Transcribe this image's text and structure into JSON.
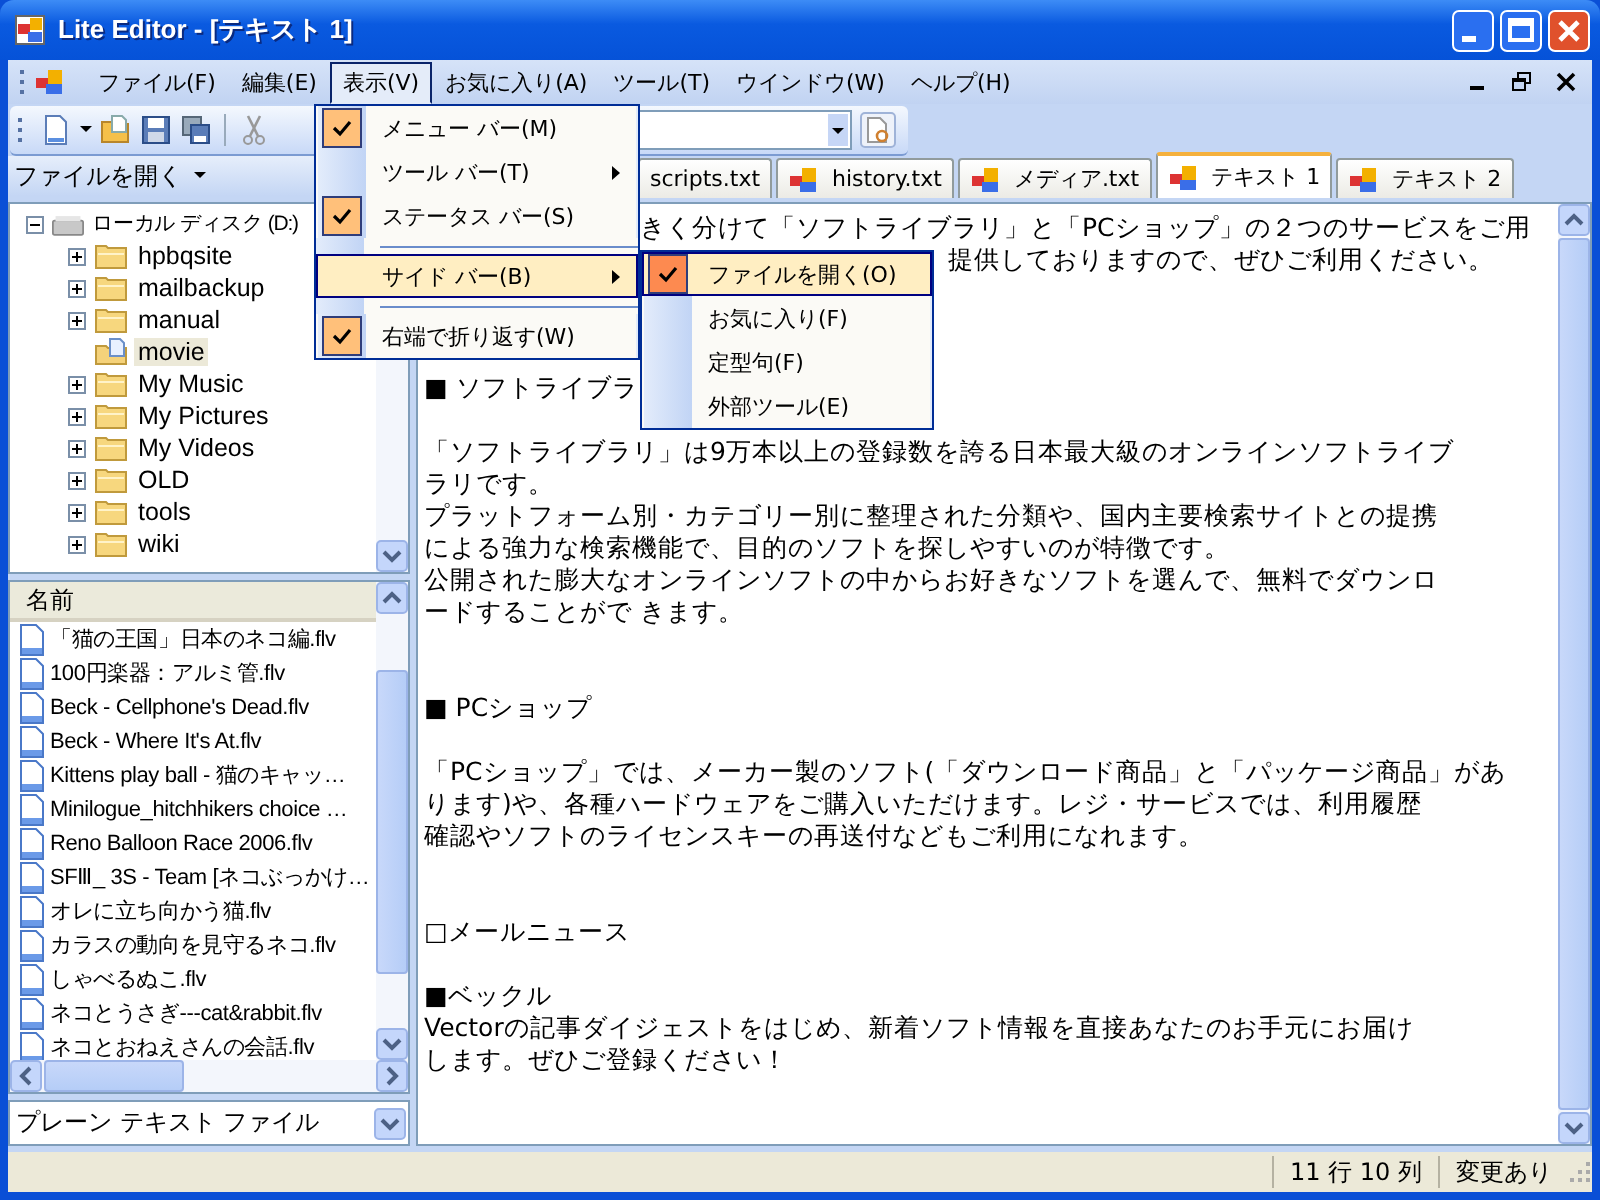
{
  "window": {
    "title": "Lite Editor - [テキスト 1]"
  },
  "menu_bar": {
    "items": [
      {
        "label": "ファイル(F)",
        "selected": false
      },
      {
        "label": "編集(E)",
        "selected": false
      },
      {
        "label": "表示(V)",
        "selected": true
      },
      {
        "label": "お気に入り(A)",
        "selected": false
      },
      {
        "label": "ツール(T)",
        "selected": false
      },
      {
        "label": "ウインドウ(W)",
        "selected": false
      },
      {
        "label": "ヘルプ(H)",
        "selected": false
      }
    ]
  },
  "view_menu": {
    "items": [
      {
        "kind": "item",
        "label": "メニュー バー(M)",
        "checked": true,
        "submenu": false,
        "selected": false
      },
      {
        "kind": "item",
        "label": "ツール バー(T)",
        "checked": false,
        "submenu": true,
        "selected": false
      },
      {
        "kind": "item",
        "label": "ステータス バー(S)",
        "checked": true,
        "submenu": false,
        "selected": false
      },
      {
        "kind": "separator"
      },
      {
        "kind": "item",
        "label": "サイド バー(B)",
        "checked": false,
        "submenu": true,
        "selected": true
      },
      {
        "kind": "separator"
      },
      {
        "kind": "item",
        "label": "右端で折り返す(W)",
        "checked": true,
        "submenu": false,
        "selected": false
      }
    ]
  },
  "sidebar_menu": {
    "items": [
      {
        "label": "ファイルを開く(O)",
        "checked": true,
        "selected": true
      },
      {
        "label": "お気に入り(F)",
        "checked": false,
        "selected": false
      },
      {
        "label": "定型句(F)",
        "checked": false,
        "selected": false
      },
      {
        "label": "外部ツール(E)",
        "checked": false,
        "selected": false
      }
    ]
  },
  "sidebar": {
    "header": "ファイルを開く",
    "tree": {
      "label": "ローカル ディスク (D:)",
      "expanded": true,
      "children": [
        {
          "label": "hpbqsite",
          "expandable": true,
          "selected": false
        },
        {
          "label": "mailbackup",
          "expandable": true,
          "selected": false
        },
        {
          "label": "manual",
          "expandable": true,
          "selected": false
        },
        {
          "label": "movie",
          "expandable": false,
          "selected": true
        },
        {
          "label": "My Music",
          "expandable": true,
          "selected": false
        },
        {
          "label": "My Pictures",
          "expandable": true,
          "selected": false
        },
        {
          "label": "My Videos",
          "expandable": true,
          "selected": false
        },
        {
          "label": "OLD",
          "expandable": true,
          "selected": false
        },
        {
          "label": "tools",
          "expandable": true,
          "selected": false
        },
        {
          "label": "wiki",
          "expandable": true,
          "selected": false
        }
      ]
    },
    "list": {
      "column": "名前",
      "items": [
        "「猫の王国」日本のネコ編.flv",
        "100円楽器：アルミ管.flv",
        "Beck - Cellphone's Dead.flv",
        "Beck - Where It's At.flv",
        "Kittens play ball - 猫のキャッ…",
        "Minilogue_hitchhikers choice …",
        "Reno Balloon Race 2006.flv",
        "SFⅢ_ 3S - Team [ネコぶっかけ…",
        "オレに立ち向かう猫.flv",
        "カラスの動向を見守るネコ.flv",
        "しゃべるぬこ.flv",
        "ネコとうさぎ---cat&rabbit.flv",
        "ネコとおねえさんの会話.flv"
      ]
    },
    "file_type": "プレーン テキスト ファイル"
  },
  "tabs": [
    {
      "label": "scripts.txt",
      "selected": false
    },
    {
      "label": "history.txt",
      "selected": false
    },
    {
      "label": "メディア.txt",
      "selected": false
    },
    {
      "label": "テキスト 1",
      "selected": true
    },
    {
      "label": "テキスト 2",
      "selected": false
    }
  ],
  "editor": {
    "lines": [
      {
        "kind": "right-of-menu",
        "text": "きく分けて「ソフトライブラリ」と「PCショップ」の２つのサービスをご用"
      },
      {
        "kind": "right-of-submenu",
        "text": "提供しておりますので、ぜひご利用ください。"
      },
      {
        "kind": "blank"
      },
      {
        "kind": "blank"
      },
      {
        "kind": "blank"
      },
      {
        "kind": "line",
        "text": "■ ソフトライブラ"
      },
      {
        "kind": "blank"
      },
      {
        "kind": "line",
        "text": "「ソフトライブラリ」は9万本以上の登録数を誇る日本最大級のオンラインソフトライブ"
      },
      {
        "kind": "line",
        "text": "ラリです。"
      },
      {
        "kind": "line",
        "text": "プラットフォーム別・カテゴリー別に整理された分類や、国内主要検索サイトとの提携"
      },
      {
        "kind": "line",
        "text": "による強力な検索機能で、目的のソフトを探しやすいのが特徴です。"
      },
      {
        "kind": "line",
        "text": "公開された膨大なオンラインソフトの中からお好きなソフトを選んで、無料でダウンロ"
      },
      {
        "kind": "line",
        "text": "ードすることがで きます。"
      },
      {
        "kind": "blank"
      },
      {
        "kind": "blank"
      },
      {
        "kind": "line",
        "text": "■ PCショップ"
      },
      {
        "kind": "blank"
      },
      {
        "kind": "line",
        "text": "「PCショップ」では、メーカー製のソフト(「ダウンロード商品」と「パッケージ商品」があ"
      },
      {
        "kind": "line",
        "text": "ります)や、各種ハードウェアをご購入いただけます。レジ・サービスでは、利用履歴"
      },
      {
        "kind": "line",
        "text": "確認やソフトのライセンスキーの再送付などもご利用になれます。"
      },
      {
        "kind": "blank"
      },
      {
        "kind": "blank"
      },
      {
        "kind": "line",
        "text": "□メールニュース"
      },
      {
        "kind": "blank"
      },
      {
        "kind": "line",
        "text": "■ベックル"
      },
      {
        "kind": "line",
        "text": "Vectorの記事ダイジェストをはじめ、新着ソフト情報を直接あなたのお手元にお届け"
      },
      {
        "kind": "line",
        "text": "します。ぜひご登録ください！"
      }
    ]
  },
  "status_bar": {
    "position": "11 行 10 列",
    "modified": "変更あり"
  }
}
